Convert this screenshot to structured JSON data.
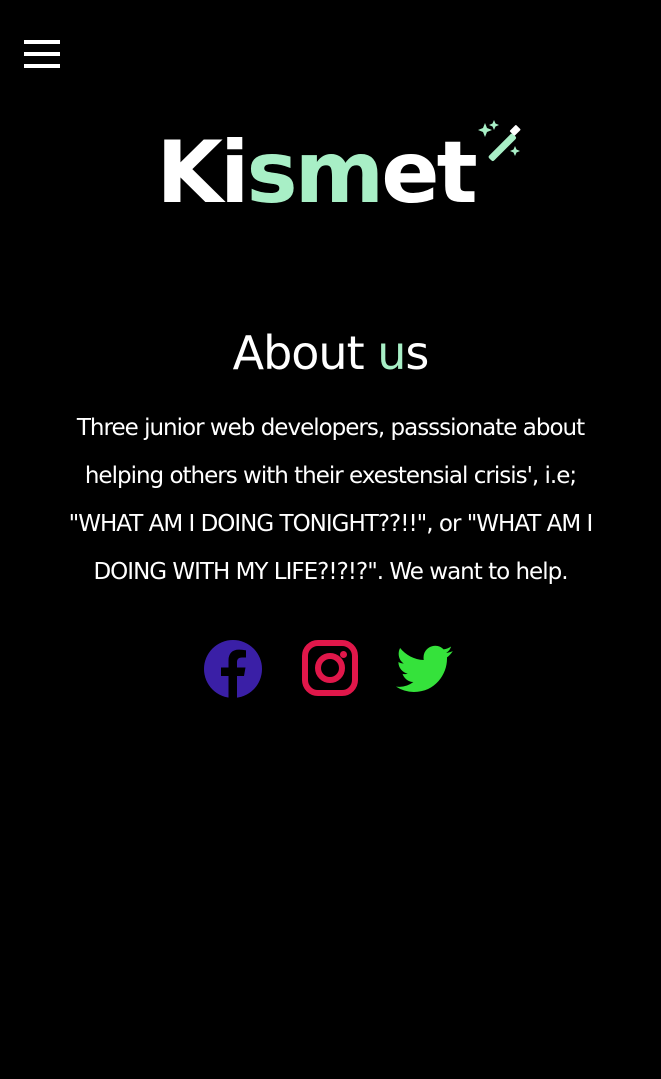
{
  "header": {
    "menu_icon": "hamburger-menu-icon"
  },
  "logo": {
    "part1": "Ki",
    "part2": "sm",
    "part3": "et",
    "icon": "magic-wand-sparkles-icon"
  },
  "about": {
    "title_part1": "About ",
    "title_part2": "u",
    "title_part3": "s",
    "text": "Three junior web developers, passsionate about helping others with their exestensial crisis', i.e; \"WHAT AM I DOING TONIGHT??!!\", or \"WHAT AM I DOING WITH MY LIFE?!?!?\". We want to help."
  },
  "social": [
    {
      "name": "facebook",
      "icon": "facebook-icon",
      "color": "#3a1fa6"
    },
    {
      "name": "instagram",
      "icon": "instagram-icon",
      "color": "#e0174a"
    },
    {
      "name": "twitter",
      "icon": "twitter-icon",
      "color": "#35e23b"
    }
  ],
  "colors": {
    "background": "#000000",
    "text": "#ffffff",
    "accent": "#a8efc6"
  }
}
